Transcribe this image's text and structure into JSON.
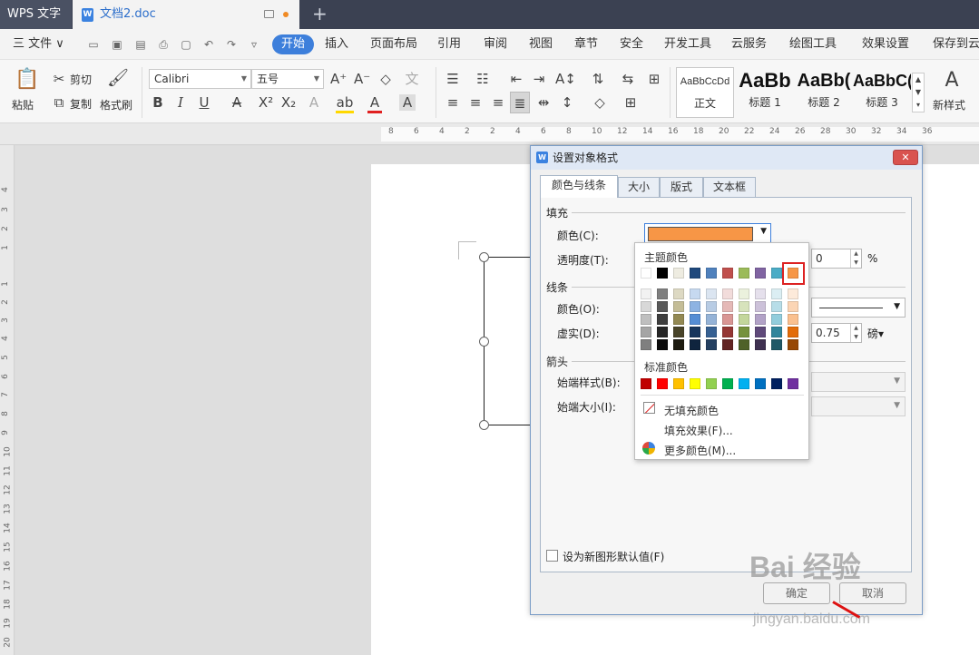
{
  "titlebar": {
    "app": "WPS 文字",
    "doc_tab": "文档2.doc",
    "new_tab": "+"
  },
  "menubar": {
    "file": "三 文件 ∨",
    "items": [
      "开始",
      "插入",
      "页面布局",
      "引用",
      "审阅",
      "视图",
      "章节",
      "安全",
      "开发工具",
      "云服务",
      "绘图工具",
      "效果设置",
      "保存到云"
    ]
  },
  "ribbon": {
    "paste": "粘贴",
    "cut": "剪切",
    "copy": "复制",
    "format_painter": "格式刷",
    "font_name": "Calibri",
    "font_size": "五号",
    "styles": [
      {
        "preview": "AaBbCcDd",
        "label": "正文"
      },
      {
        "preview": "AaBb",
        "label": "标题 1"
      },
      {
        "preview": "AaBb(",
        "label": "标题 2"
      },
      {
        "preview": "AaBbC(",
        "label": "标题 3"
      }
    ],
    "new_style": "新样式"
  },
  "ruler": {
    "h_ticks": [
      "8",
      "6",
      "4",
      "2",
      "2",
      "4",
      "6",
      "8",
      "10",
      "12",
      "14",
      "16",
      "18",
      "20",
      "22",
      "24",
      "26",
      "28",
      "30",
      "32",
      "34",
      "36"
    ],
    "v_ticks": [
      "4",
      "3",
      "2",
      "1",
      "1",
      "2",
      "3",
      "4",
      "5",
      "6",
      "7",
      "8",
      "9",
      "10",
      "11",
      "12",
      "13",
      "14",
      "15",
      "16",
      "17",
      "18",
      "19",
      "20"
    ]
  },
  "dialog": {
    "title": "设置对象格式",
    "close": "✕",
    "tabs": [
      "颜色与线条",
      "大小",
      "版式",
      "文本框"
    ],
    "fill_group": "填充",
    "color_label": "颜色(C):",
    "transparency_label": "透明度(T):",
    "transparency_value": "0",
    "percent": "%",
    "line_group": "线条",
    "line_color_label": "颜色(O):",
    "dash_label": "虚实(D):",
    "weight_value": "0.75",
    "weight_unit": "磅▾",
    "arrow_group": "箭头",
    "begin_style_label": "始端样式(B):",
    "begin_size_label": "始端大小(I):",
    "default_checkbox": "设为新图形默认值(F)",
    "ok": "确定",
    "cancel": "取消",
    "fill_color": "#f79646"
  },
  "picker": {
    "theme_title": "主题颜色",
    "standard_title": "标准颜色",
    "no_fill": "无填充颜色",
    "fill_effects": "填充效果(F)...",
    "more_colors": "更多颜色(M)...",
    "theme_row": [
      "#ffffff",
      "#000000",
      "#eeece1",
      "#1f497d",
      "#4f81bd",
      "#c0504d",
      "#9bbb59",
      "#8064a2",
      "#4bacc6",
      "#f79646"
    ],
    "theme_shades": [
      [
        "#f2f2f2",
        "#7f7f7f",
        "#ddd9c3",
        "#c6d9f0",
        "#dbe5f1",
        "#f2dcdb",
        "#ebf1dd",
        "#e5e0ec",
        "#dbeef3",
        "#fdeada"
      ],
      [
        "#d8d8d8",
        "#595959",
        "#c4bd97",
        "#8db3e2",
        "#b8cce4",
        "#e5b9b7",
        "#d7e3bc",
        "#ccc1d9",
        "#b7dde8",
        "#fbd5b5"
      ],
      [
        "#bfbfbf",
        "#3f3f3f",
        "#938953",
        "#548dd4",
        "#95b3d7",
        "#d99694",
        "#c3d69b",
        "#b2a2c7",
        "#92cddc",
        "#fac08f"
      ],
      [
        "#a5a5a5",
        "#262626",
        "#494429",
        "#17365d",
        "#366092",
        "#953734",
        "#76923c",
        "#5f497a",
        "#31859b",
        "#e36c09"
      ],
      [
        "#7f7f7f",
        "#0c0c0c",
        "#1d1b10",
        "#0f243e",
        "#244061",
        "#632423",
        "#4f6128",
        "#3f3151",
        "#205867",
        "#974806"
      ]
    ],
    "standard_row": [
      "#c00000",
      "#ff0000",
      "#ffc000",
      "#ffff00",
      "#92d050",
      "#00b050",
      "#00b0f0",
      "#0070c0",
      "#002060",
      "#7030a0"
    ]
  },
  "watermark": {
    "text": "Bai 经验",
    "url": "jingyan.baidu.com"
  }
}
